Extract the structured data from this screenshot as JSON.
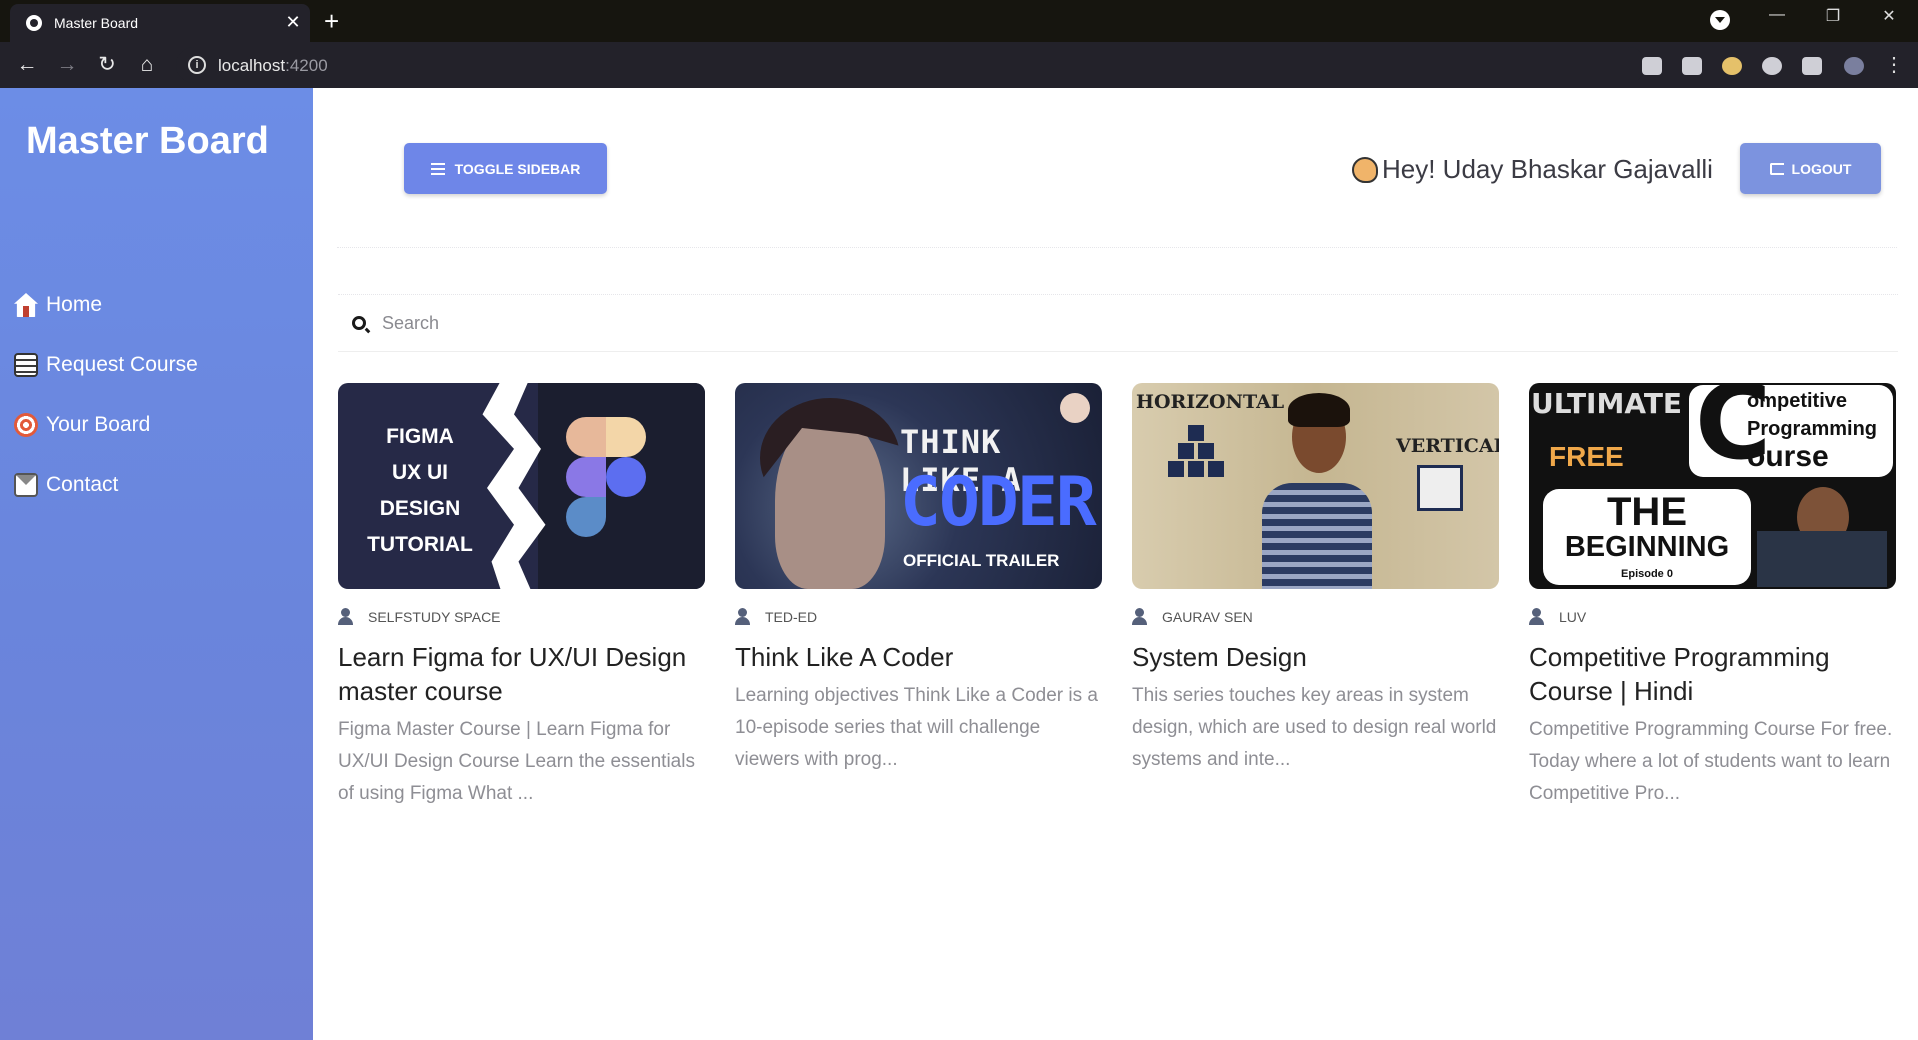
{
  "browser": {
    "tab_title": "Master Board",
    "tab_close": "✕",
    "new_tab": "+",
    "url_host": "localhost",
    "url_port": ":4200",
    "win_minimize": "—",
    "win_restore": "❐",
    "win_close": "✕"
  },
  "sidebar": {
    "brand": "Master Board",
    "items": [
      {
        "label": "Home",
        "icon": "home-icon"
      },
      {
        "label": "Request Course",
        "icon": "books-icon"
      },
      {
        "label": "Your Board",
        "icon": "target-icon"
      },
      {
        "label": "Contact",
        "icon": "envelope-icon"
      }
    ]
  },
  "header": {
    "toggle_label": "TOGGLE SIDEBAR",
    "greeting": "Hey! Uday Bhaskar Gajavalli",
    "logout_label": "LOGOUT"
  },
  "search": {
    "placeholder": "Search",
    "value": ""
  },
  "courses": [
    {
      "channel": "SELFSTUDY SPACE",
      "title": "Learn Figma for UX/UI Design master course",
      "description": "Figma Master Course | Learn Figma for UX/UI Design Course Learn the essentials of using Figma What ...",
      "thumb_text": [
        "FIGMA",
        "UX UI",
        "DESIGN",
        "TUTORIAL"
      ]
    },
    {
      "channel": "TED-ED",
      "title": "Think Like A Coder",
      "description": "Learning objectives Think Like a Coder is a 10-episode series that will challenge viewers with prog...",
      "thumb_text": [
        "THINK LIKE A",
        "CODER",
        "OFFICIAL TRAILER"
      ]
    },
    {
      "channel": "GAURAV SEN",
      "title": "System Design",
      "description": "This series touches key areas in system design, which are used to design real world systems and inte...",
      "thumb_text": [
        "HORIZONTAL",
        "VERTICAL"
      ]
    },
    {
      "channel": "LUV",
      "title": "Competitive Programming Course | Hindi",
      "description": "Competitive Programming Course For free. Today where a lot of students want to learn Competitive Pro...",
      "thumb_text": [
        "ULTIMATE",
        "FREE",
        "ompetitive",
        "Programming",
        "ourse",
        "THE",
        "BEGINNING",
        "Episode 0"
      ]
    }
  ],
  "colors": {
    "sidebar": "#6c8de6",
    "accent_button": "#6e86e8",
    "logout_button": "#7c93df",
    "chrome_dark": "#23222a"
  }
}
